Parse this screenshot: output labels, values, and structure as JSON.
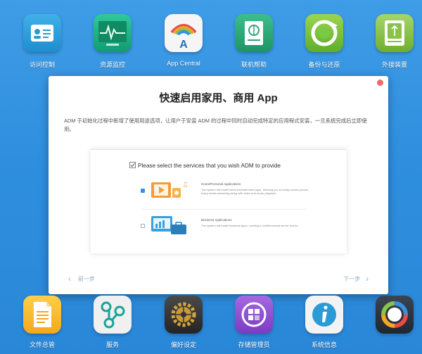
{
  "top_apps": [
    {
      "label": "访问控制",
      "icon": "id-card-icon",
      "color": "#2a9bd6"
    },
    {
      "label": "资源监控",
      "icon": "heartbeat-monitor-icon",
      "color": "#1db58a"
    },
    {
      "label": "App Central",
      "icon": "app-central-icon",
      "color": "#f2f2f2"
    },
    {
      "label": "联机帮助",
      "icon": "help-book-icon",
      "color": "#2ea37a"
    },
    {
      "label": "备份与还原",
      "icon": "backup-restore-icon",
      "color": "#7ac943"
    },
    {
      "label": "外接装置",
      "icon": "external-device-icon",
      "color": "#8bc34a"
    }
  ],
  "bottom_apps": [
    {
      "label": "文件总管",
      "icon": "file-explorer-icon",
      "color": "#f7b928"
    },
    {
      "label": "服务",
      "icon": "services-icon",
      "color": "#e9e9e9"
    },
    {
      "label": "偏好设定",
      "icon": "preferences-gear-icon",
      "color": "#3a3a3a"
    },
    {
      "label": "存储管理员",
      "icon": "storage-manager-icon",
      "color": "#8e4fd1"
    },
    {
      "label": "系统信息",
      "icon": "system-info-icon",
      "color": "#f2f2f2"
    },
    {
      "label": "",
      "icon": "activity-monitor-icon",
      "color": "#2f3a46"
    }
  ],
  "dialog": {
    "title": "快速启用家用、商用 App",
    "description": "ADM 于初始化过程中新增了使用用途选项，让用户于安装 ADM 的过程中同时自动完成特定的应用程式安装，一旦系统完成后立即使用。",
    "preview": {
      "title": "Please select the services that you wish ADM to provide",
      "options": [
        {
          "heading": "Home/Personal Applications",
          "description": "The system will install home entertainment Apps, allowing you to easily access photos, enjoy media streaming along with video and music playback.",
          "checked": true
        },
        {
          "heading": "Business Applications",
          "description": "The system will install business Apps, creating a multifunctional server and an",
          "checked": false
        }
      ]
    },
    "prev_label": "前一步",
    "next_label": "下一步"
  }
}
